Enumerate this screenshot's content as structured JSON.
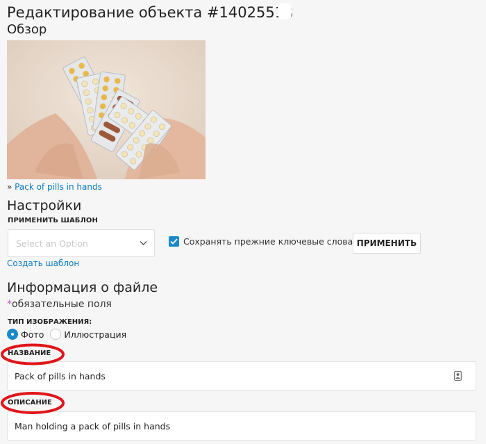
{
  "header": {
    "title": "Редактирование объекта #14025513"
  },
  "overview": {
    "heading": "Обзор",
    "image_alt": "Pack of pills in hands",
    "link_prefix": "»",
    "link_text": "Pack of pills in hands"
  },
  "settings": {
    "heading": "Настройки",
    "template_label": "ПРИМЕНИТЬ ШАБЛОН",
    "template_placeholder": "Select an Option",
    "keep_keywords_label": "Сохранять прежние ключевые слова",
    "keep_keywords_checked": true,
    "apply_button": "ПРИМЕНИТЬ",
    "create_template_link": "Создать шаблон"
  },
  "file_info": {
    "heading": "Информация о файле",
    "required_star": "*",
    "required_note": "обязательные поля",
    "image_type_label": "ТИП ИЗОБРАЖЕНИЯ:",
    "image_type_options": [
      {
        "label": "Фото",
        "selected": true
      },
      {
        "label": "Иллюстрация",
        "selected": false
      }
    ],
    "name_label": "НАЗВАНИЕ",
    "name_value": "Pack of pills in hands",
    "description_label": "ОПИСАНИЕ",
    "description_value": "Man holding a pack of pills in hands"
  },
  "colors": {
    "accent": "#1a89c9",
    "link": "#0a7ac0",
    "required_star": "#c55ec9",
    "annotation": "#e0161b"
  },
  "icons": {
    "select_chevron": "chevron-down-icon",
    "checkbox_check": "check-icon",
    "name_field_icon": "contact-card-icon"
  }
}
